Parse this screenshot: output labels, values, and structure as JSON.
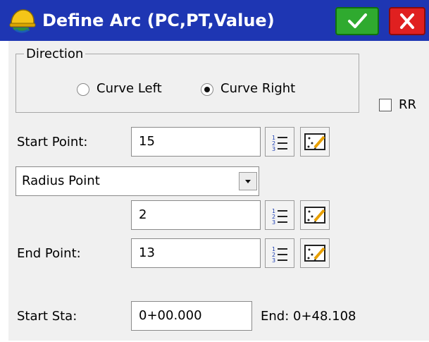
{
  "window": {
    "title": "Define Arc (PC,PT,Value)"
  },
  "direction": {
    "legend": "Direction",
    "options": [
      {
        "label": "Curve Left",
        "checked": false
      },
      {
        "label": "Curve Right",
        "checked": true
      }
    ]
  },
  "rr": {
    "label": "RR",
    "checked": false
  },
  "start_point": {
    "label": "Start Point:",
    "value": "15"
  },
  "radius": {
    "selected": "Radius Point",
    "value": "2"
  },
  "end_point": {
    "label": "End Point:",
    "value": "13"
  },
  "station": {
    "label": "Start Sta:",
    "value": "0+00.000",
    "end_text": "End: 0+48.108"
  },
  "icons": {
    "title": "surveyor-helmet-icon",
    "ok": "checkmark-icon",
    "close": "close-x-icon",
    "list": "numbered-list-icon",
    "map": "map-pick-icon",
    "dropdown": "dropdown-arrow-icon"
  },
  "colors": {
    "titlebar": "#1e36b3",
    "ok_button": "#2faa2f",
    "close_button": "#e02020",
    "client_bg": "#f0f0f0"
  }
}
